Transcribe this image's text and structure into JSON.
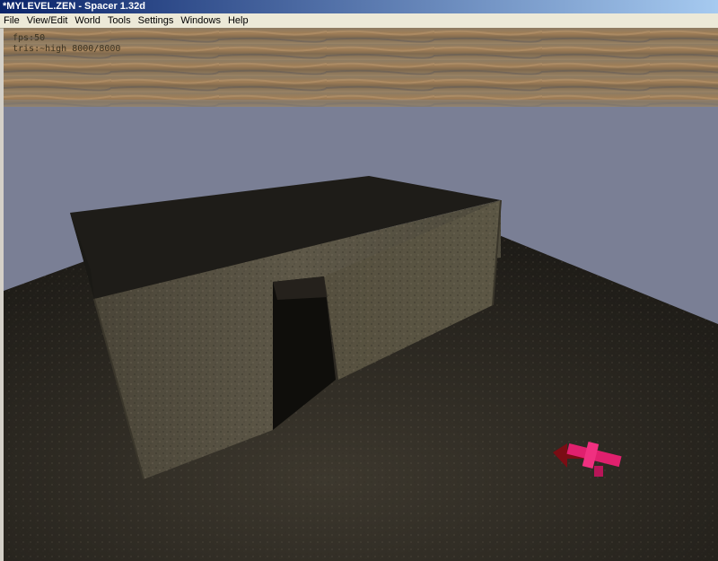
{
  "window": {
    "title": "*MYLEVEL.ZEN - Spacer 1.32d"
  },
  "menu": {
    "items": [
      {
        "label": "File"
      },
      {
        "label": "View/Edit"
      },
      {
        "label": "World"
      },
      {
        "label": "Tools"
      },
      {
        "label": "Settings"
      },
      {
        "label": "Windows"
      },
      {
        "label": "Help"
      }
    ]
  },
  "viewport": {
    "hud_fps": "fps:50",
    "hud_stats": "tris:~high 8000/8000",
    "colors": {
      "sky": "#7a7f95",
      "ground": "#2e2a22",
      "wall": "#5a5446",
      "roof": "#1e1c18",
      "skytexture": "#8a7458",
      "arrow": "#e0206e"
    }
  }
}
